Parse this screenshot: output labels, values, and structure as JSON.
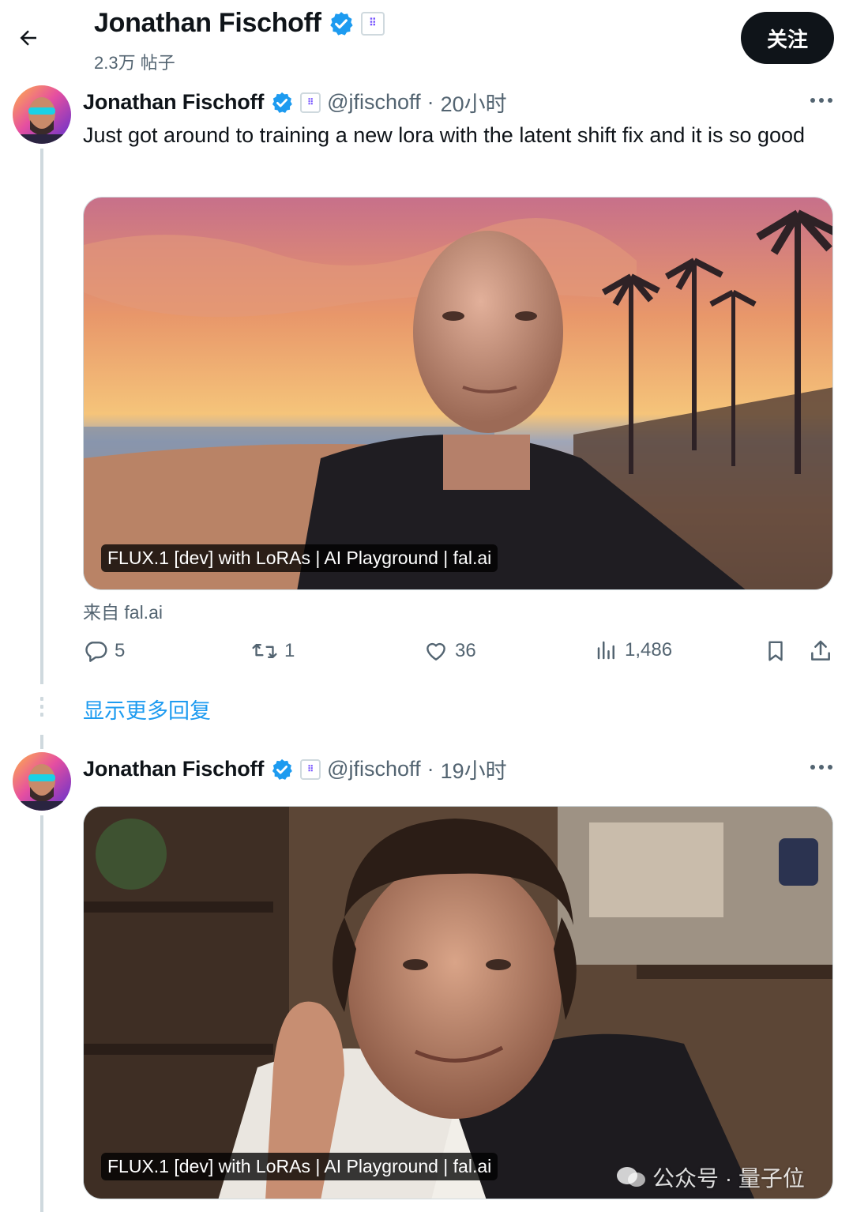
{
  "header": {
    "name": "Jonathan Fischoff",
    "post_count": "2.3万 帖子",
    "follow_label": "关注"
  },
  "tweets": [
    {
      "name": "Jonathan Fischoff",
      "handle": "@jfischoff",
      "dot": "·",
      "time": "20小时",
      "text": "Just got around to training a new lora with the latent shift fix and it is so good",
      "card_label": "FLUX.1 [dev] with LoRAs | AI Playground | fal.ai",
      "source": "来自 fal.ai",
      "actions": {
        "replies": "5",
        "reposts": "1",
        "likes": "36",
        "views": "1,486"
      }
    },
    {
      "name": "Jonathan Fischoff",
      "handle": "@jfischoff",
      "dot": "·",
      "time": "19小时",
      "card_label": "FLUX.1 [dev] with LoRAs | AI Playground | fal.ai"
    }
  ],
  "show_more_label": "显示更多回复",
  "watermark": "公众号 · 量子位",
  "colors": {
    "accent": "#1d9bf0",
    "text": "#0f1419",
    "secondary": "#536471",
    "verified": "#1d9bf0"
  },
  "icons": [
    "back-arrow-icon",
    "verified-icon",
    "affiliate-badge-icon",
    "more-icon",
    "reply-icon",
    "repost-icon",
    "like-icon",
    "views-icon",
    "bookmark-icon",
    "share-icon"
  ]
}
